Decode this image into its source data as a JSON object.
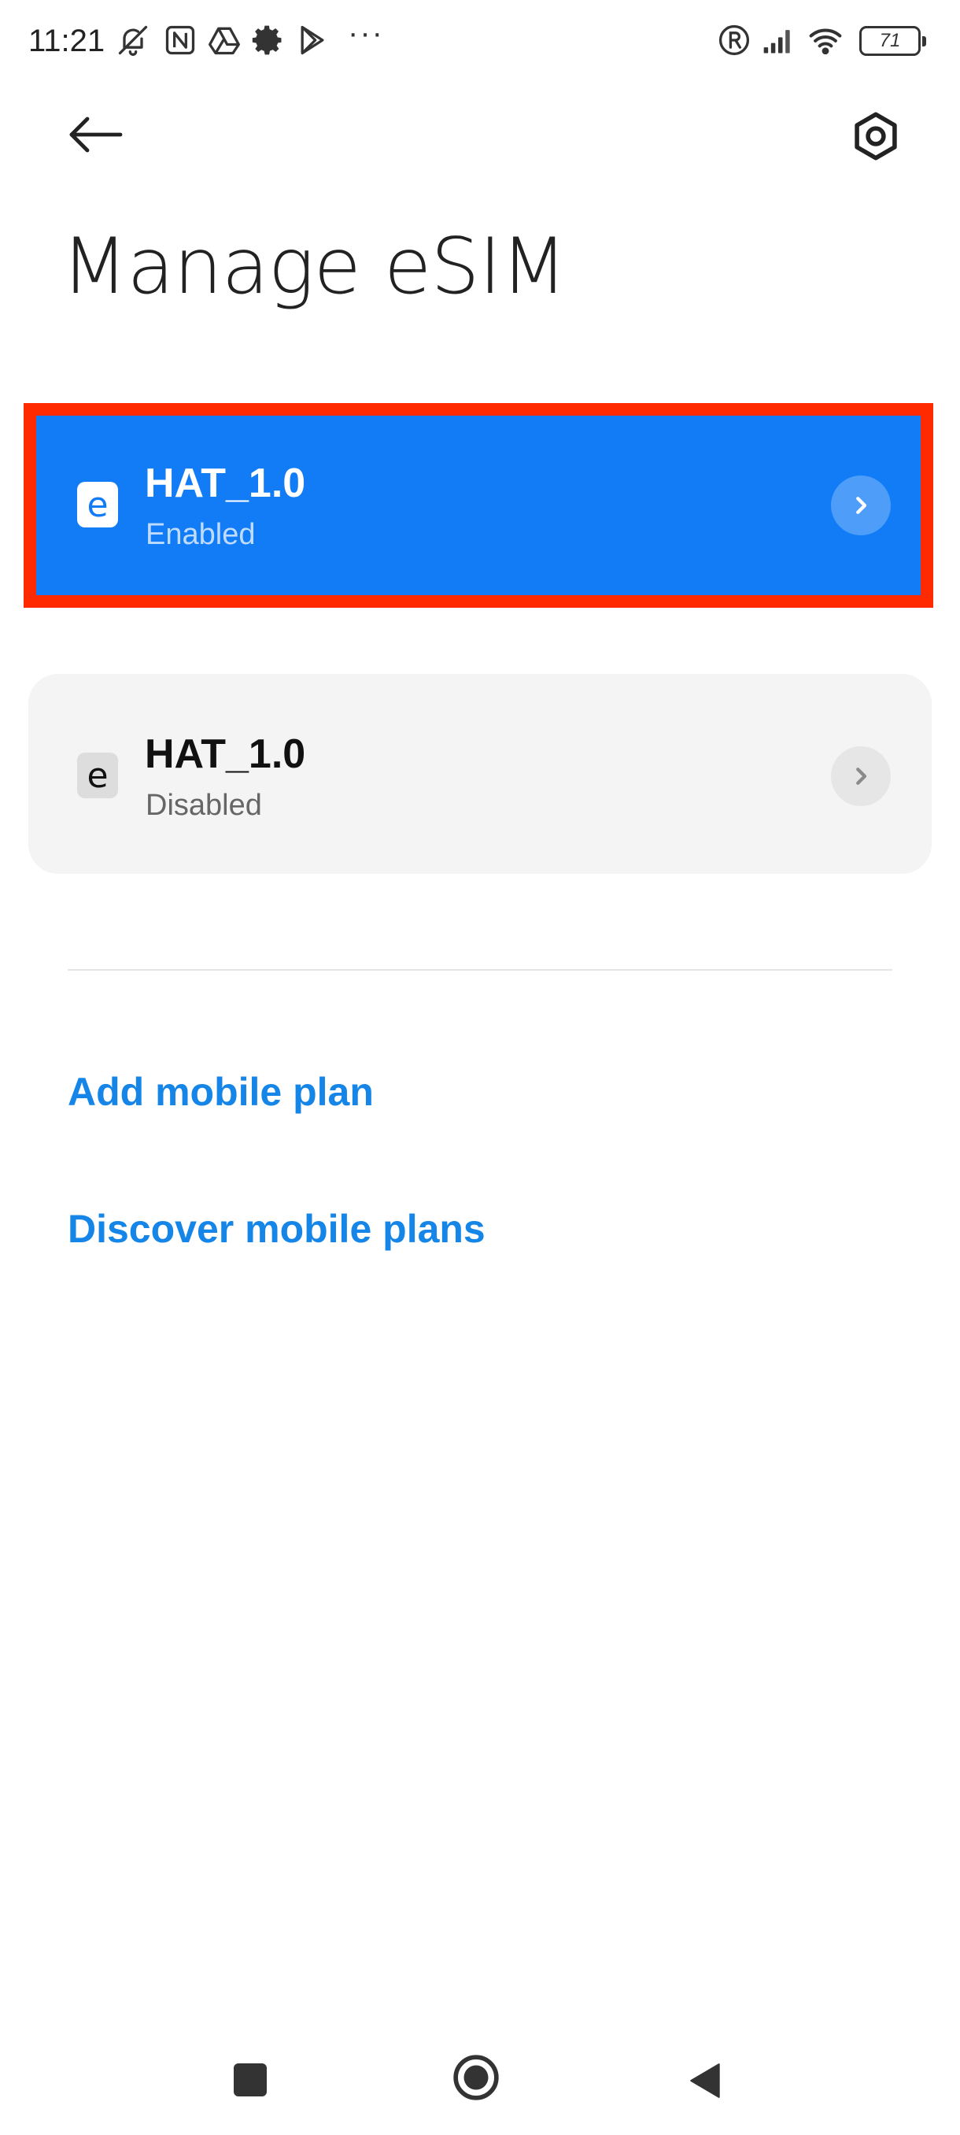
{
  "status_bar": {
    "time": "11:21",
    "battery": "71",
    "icons": [
      "bell-off-icon",
      "nfc-icon",
      "drive-icon",
      "gear-icon",
      "play-store-icon",
      "more-icon",
      "roaming-icon",
      "signal-icon",
      "wifi-icon",
      "battery-icon"
    ],
    "more": "···"
  },
  "header": {
    "back_icon": "arrow-left-icon",
    "settings_icon": "hexagon-settings-icon",
    "title": "Manage eSIM"
  },
  "esims": [
    {
      "name": "HAT_1.0",
      "status": "Enabled",
      "icon_letter": "e",
      "active": true
    },
    {
      "name": "HAT_1.0",
      "status": "Disabled",
      "icon_letter": "e",
      "active": false
    }
  ],
  "actions": {
    "add_plan": "Add mobile plan",
    "discover_plans": "Discover mobile plans"
  },
  "colors": {
    "accent": "#127cf7",
    "link": "#1585e8",
    "highlight": "#ff2a00"
  }
}
